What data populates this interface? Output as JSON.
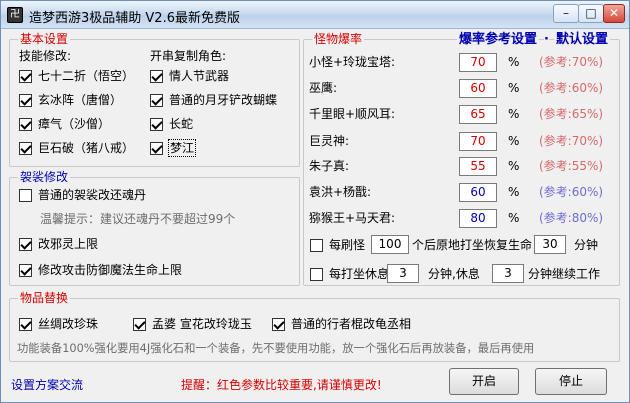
{
  "window": {
    "title": "造梦西游3极品辅助  V2.6最新免费版",
    "app_icon": "卍",
    "controls": {
      "minimize": "–",
      "maximize": "□",
      "close": "✕"
    }
  },
  "basic": {
    "title": "基本设置",
    "skills_label": "技能修改:",
    "roles_label": "开串复制角色:",
    "skills": [
      {
        "label": "七十二折（悟空）",
        "checked": true
      },
      {
        "label": "玄冰阵（唐僧）",
        "checked": true
      },
      {
        "label": "瘴气（沙僧）",
        "checked": true
      },
      {
        "label": "巨石破（猪八戒）",
        "checked": true
      }
    ],
    "roles": [
      {
        "label": "情人节武器",
        "checked": true
      },
      {
        "label": "普通的月牙铲改蝴蝶",
        "checked": true
      },
      {
        "label": "长蛇",
        "checked": true
      },
      {
        "label": "梦江",
        "checked": true
      }
    ]
  },
  "armor": {
    "title": "袈裟修改",
    "item1": {
      "label": "普通的袈裟改还魂丹",
      "checked": false
    },
    "tip": "温馨提示：建议还魂丹不要超过99个",
    "item2": {
      "label": "改邪灵上限",
      "checked": true
    },
    "item3": {
      "label": "修改攻击防御魔法生命上限",
      "checked": true
    }
  },
  "monster": {
    "title": "怪物爆率",
    "link_rates": "爆率参考设置",
    "separator": "·",
    "link_default": "默认设置",
    "unit": "%",
    "rows": [
      {
        "name": "小怪+玲珑宝塔:",
        "value": "70",
        "ref": "(参考:70%)"
      },
      {
        "name": "巫鹰:",
        "value": "60",
        "ref": "(参考:60%)"
      },
      {
        "name": "千里眼+顺风耳:",
        "value": "65",
        "ref": "(参考:65%)"
      },
      {
        "name": "巨灵神:",
        "value": "70",
        "ref": "(参考:70%)"
      },
      {
        "name": "朱子真:",
        "value": "55",
        "ref": "(参考:55%)"
      },
      {
        "name": "袁洪+杨戬:",
        "value": "60",
        "ref": "(参考:60%)"
      },
      {
        "name": "猕猴王+马天君:",
        "value": "80",
        "ref": "(参考:80%)"
      }
    ],
    "refresh": {
      "checked": false,
      "label_pre": "每刷怪",
      "count": "100",
      "label_mid": "个后原地打坐恢复生命",
      "minutes": "30",
      "label_post": "分钟"
    },
    "rest": {
      "checked": false,
      "label_pre": "每打坐休息",
      "rest_min": "3",
      "label_mid": "分钟,休息",
      "cont_min": "3",
      "label_post": "分钟继续工作"
    }
  },
  "items": {
    "title": "物品替换",
    "item1": {
      "label": "丝绸改珍珠",
      "checked": true
    },
    "item2": {
      "label": "孟婆 宣花改玲珑玉",
      "checked": true
    },
    "item3": {
      "label": "普通的行者棍改龟丞相",
      "checked": true
    },
    "note": "功能装备100%强化要用4J强化石和一个装备，先不要使用功能，放一个强化石后再放装备，最后再使用"
  },
  "footer": {
    "link": "设置方案交流",
    "warning": "提醒：红色参数比较重要,请谨慎更改!",
    "start": "开启",
    "stop": "停止"
  }
}
